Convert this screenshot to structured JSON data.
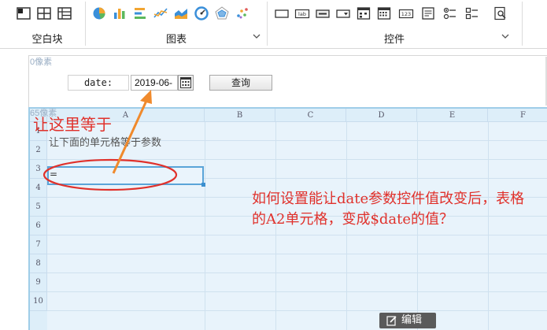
{
  "ribbon": {
    "groups": [
      {
        "label": "空白块",
        "icons": [
          "absolute-block-icon",
          "split-block-icon",
          "frame-block-icon"
        ]
      },
      {
        "label": "图表",
        "icons": [
          "pie-chart-icon",
          "bar-chart-icon",
          "horizontal-bar-chart-icon",
          "line-chart-icon",
          "area-chart-icon",
          "gauge-chart-icon",
          "radar-chart-icon",
          "scatter-chart-icon"
        ]
      },
      {
        "label": "控件",
        "icons": [
          "text-field-icon",
          "label-icon",
          "button-control-icon",
          "dropdown-icon",
          "date-picker-icon",
          "calendar-grid-icon",
          "number-field-icon",
          "textarea-icon",
          "radio-group-icon",
          "checkbox-group-icon",
          "query-search-icon"
        ]
      }
    ],
    "number_icon_text": "123",
    "label_icon_text": "lab"
  },
  "canvas": {
    "top_label": "0像素",
    "grid_label": "65像素",
    "parameter": {
      "label": "date:",
      "value": "2019-06-",
      "query_button": "查询"
    }
  },
  "grid": {
    "columns": [
      "A",
      "B",
      "C",
      "D",
      "E",
      "F"
    ],
    "rows": [
      "1",
      "2",
      "3",
      "4",
      "5",
      "6",
      "7",
      "8",
      "9",
      "10"
    ],
    "a1": "让下面的单元格等于参数",
    "a2": "="
  },
  "annotations": {
    "top_note": "让这里等于",
    "question": "如何设置能让date参数控件值改变后，表格的A2单元格，变成$date的值？"
  },
  "edit_button": "编辑",
  "colors": {
    "annotation_red": "#e0312b",
    "arrow_orange": "#f08a2c",
    "grid_blue": "#ddeef9",
    "selection_blue": "#5aa4d8"
  }
}
